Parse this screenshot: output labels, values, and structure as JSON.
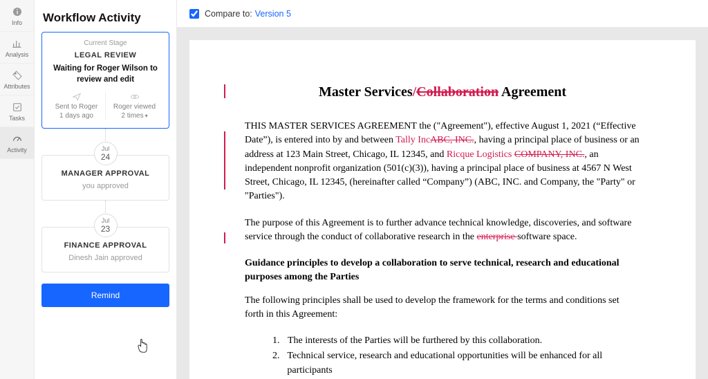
{
  "rail": {
    "items": [
      {
        "label": "Info"
      },
      {
        "label": "Analysis"
      },
      {
        "label": "Attributes"
      },
      {
        "label": "Tasks"
      },
      {
        "label": "Activity"
      }
    ]
  },
  "panel": {
    "title": "Workflow Activity",
    "current": {
      "label": "Current Stage",
      "stage": "LEGAL REVIEW",
      "waiting": "Waiting for Roger Wilson to review and edit",
      "sent_label": "Sent to Roger",
      "sent_value": "1 days ago",
      "viewed_label": "Roger viewed",
      "viewed_value": "2 times"
    },
    "past": [
      {
        "month": "Jul",
        "day": "24",
        "stage": "MANAGER APPROVAL",
        "sub": "you approved"
      },
      {
        "month": "Jul",
        "day": "23",
        "stage": "FINANCE APPROVAL",
        "sub": "Dinesh Jain approved"
      }
    ],
    "remind_label": "Remind"
  },
  "compare": {
    "label": "Compare to:",
    "version": "Version 5",
    "checked": true
  },
  "doc": {
    "title_pre": "Master Services",
    "title_ins_slash": "/",
    "title_del": "Collaboration",
    "title_post": " Agreement",
    "p1_a": "THIS MASTER SERVICES AGREEMENT the (\"Agreement\"), effective August 1, 2021 (“Effective Date”), is entered into by and between ",
    "p1_ins1": "Tally Inc",
    "p1_del1": "ABC, INC.",
    "p1_b": ", having a principal place of business or an address at 123 Main Street, Chicago, IL 12345, and ",
    "p1_ins2": "Ricque Logistics",
    "p1_del2": "COMPANY, INC.",
    "p1_c": ", an independent nonprofit organization (501(c)(3)), having a principal place of business at 4567 N West Street, Chicago, IL 12345, (hereinafter called “Company”) (ABC, INC. and Company, the \"Party\" or \"Parties\").",
    "p2_a": "The purpose of this Agreement is to further advance technical knowledge, discoveries, and software service through the conduct of collaborative research in the ",
    "p2_del": "enterprise ",
    "p2_b": "software space.",
    "h2": "Guidance principles to develop a collaboration to serve technical, research and educational purposes among the Parties",
    "p3": "The following principles shall be used to develop the framework for the terms and conditions set forth in this Agreement:",
    "li1": "The interests of the Parties will be furthered by this collaboration.",
    "li2": "Technical service, research and educational opportunities will be enhanced for all participants"
  }
}
